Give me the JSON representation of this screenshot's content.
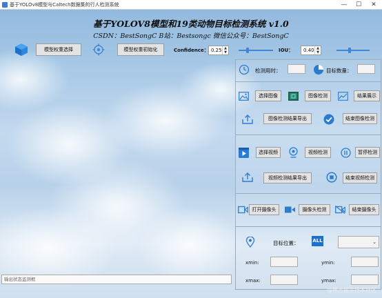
{
  "window": {
    "title": "基于YOLOv8模型与Caltech数据集的行人检测系统",
    "minimize": "—",
    "maximize": "☐",
    "close": "✕"
  },
  "header": {
    "title": "基于YOLOV8模型和19类动物目标检测系统 v1.0",
    "subtitle": "CSDN：BestSongC   B站：Bestsongc   微信公众号：BestSongC"
  },
  "toolbar": {
    "select_weights": "模型权重选择",
    "init_weights": "模型权重初始化",
    "confidence_label": "Confidence：",
    "confidence_value": "0.25",
    "iou_label": "IOU：",
    "iou_value": "0.40",
    "confidence_slider_level": 0.25,
    "iou_slider_level": 0.4
  },
  "stats": {
    "time_label": "检测用时：",
    "time_value": "",
    "count_label": "目标数量：",
    "count_value": ""
  },
  "image_section": {
    "select": "选择图像",
    "detect": "图像检测",
    "show": "结果展示",
    "export": "图像检测结果导出",
    "stop": "结束图像检测"
  },
  "video_section": {
    "select": "选择视频",
    "detect": "视频检测",
    "pause": "暂停检测",
    "export": "视频检测结果导出",
    "stop": "结束视频检测"
  },
  "camera_section": {
    "open": "打开摄像头",
    "detect": "摄像头检测",
    "close": "结束摄像头"
  },
  "target": {
    "position_label": "目标位置：",
    "all_badge": "ALL",
    "select_value": "",
    "xmin_label": "xmin:",
    "ymin_label": "ymin:",
    "xmax_label": "xmax:",
    "ymax_label": "ymax:",
    "xmin": "",
    "ymin": "",
    "xmax": "",
    "ymax": ""
  },
  "status_bar": {
    "placeholder": "输出状态监测框"
  },
  "watermark": "@稀土掘金技术社区",
  "colors": {
    "accent": "#3f86d6",
    "button_bg": "#e3e3e3"
  }
}
